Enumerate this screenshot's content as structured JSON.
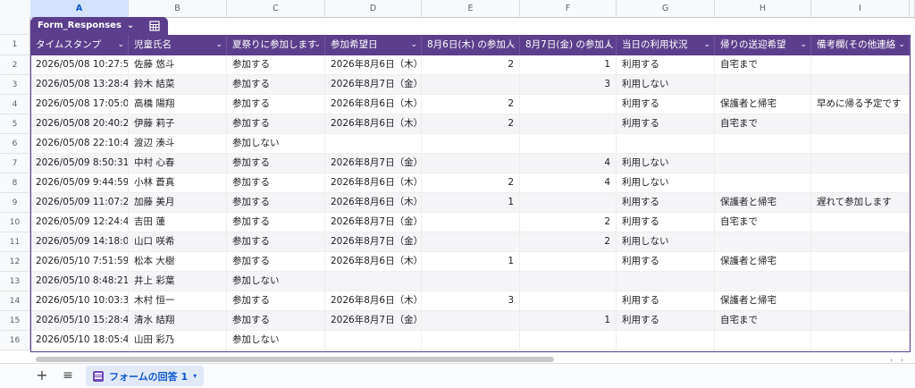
{
  "columns": [
    "A",
    "B",
    "C",
    "D",
    "E",
    "F",
    "G",
    "H",
    "I"
  ],
  "table_name": "Form_Responses",
  "headers": [
    "タイムスタンプ",
    "児童氏名",
    "夏祭りに参加します",
    "参加希望日",
    "8月6日(木) の参加人",
    "8月7日(金) の参加人",
    "当日の利用状況",
    "帰りの送迎希望",
    "備考欄(その他連絡"
  ],
  "row_numbers": [
    "1",
    "2",
    "3",
    "4",
    "5",
    "6",
    "7",
    "8",
    "9",
    "10",
    "11",
    "12",
    "13",
    "14",
    "15",
    "16"
  ],
  "rows": [
    [
      "2026/05/08 10:27:53",
      "佐藤 悠斗",
      "参加する",
      "2026年8月6日（木）, 20",
      "2",
      "1",
      "利用する",
      "自宅まで",
      ""
    ],
    [
      "2026/05/08 13:28:41",
      "鈴木 結菜",
      "参加する",
      "2026年8月7日（金）",
      "",
      "3",
      "利用しない",
      "",
      ""
    ],
    [
      "2026/05/08 17:05:06",
      "高橋 陽翔",
      "参加する",
      "2026年8月6日（木）",
      "2",
      "",
      "利用する",
      "保護者と帰宅",
      "早めに帰る予定です"
    ],
    [
      "2026/05/08 20:40:25",
      "伊藤 莉子",
      "参加する",
      "2026年8月6日（木）",
      "2",
      "",
      "利用する",
      "自宅まで",
      ""
    ],
    [
      "2026/05/08 22:10:49",
      "渡辺 湊斗",
      "参加しない",
      "",
      "",
      "",
      "",
      "",
      ""
    ],
    [
      "2026/05/09 8:50:31",
      "中村 心春",
      "参加する",
      "2026年8月7日（金）",
      "",
      "4",
      "利用しない",
      "",
      ""
    ],
    [
      "2026/05/09 9:44:59",
      "小林 蒼真",
      "参加する",
      "2026年8月6日（木）, 20",
      "2",
      "4",
      "利用しない",
      "",
      ""
    ],
    [
      "2026/05/09 11:07:27",
      "加藤 美月",
      "参加する",
      "2026年8月6日（木）",
      "1",
      "",
      "利用する",
      "保護者と帰宅",
      "遅れて参加します"
    ],
    [
      "2026/05/09 12:24:45",
      "吉田 蓮",
      "参加する",
      "2026年8月7日（金）",
      "",
      "2",
      "利用する",
      "自宅まで",
      ""
    ],
    [
      "2026/05/09 14:18:03",
      "山口 咲希",
      "参加する",
      "2026年8月7日（金）",
      "",
      "2",
      "利用しない",
      "",
      ""
    ],
    [
      "2026/05/10 7:51:59",
      "松本 大樹",
      "参加する",
      "2026年8月6日（木）",
      "1",
      "",
      "利用する",
      "保護者と帰宅",
      ""
    ],
    [
      "2026/05/10 8:48:21",
      "井上 彩葉",
      "参加しない",
      "",
      "",
      "",
      "",
      "",
      ""
    ],
    [
      "2026/05/10 10:03:38",
      "木村 恒一",
      "参加する",
      "2026年8月6日（木）",
      "3",
      "",
      "利用する",
      "保護者と帰宅",
      ""
    ],
    [
      "2026/05/10 15:28:42",
      "清水 結翔",
      "参加する",
      "2026年8月7日（金）",
      "",
      "1",
      "利用する",
      "自宅まで",
      ""
    ],
    [
      "2026/05/10 18:05:47",
      "山田 彩乃",
      "参加しない",
      "",
      "",
      "",
      "",
      "",
      ""
    ]
  ],
  "sheet_tab": "フォームの回答 1",
  "icons": {
    "add": "plus-icon",
    "list": "all-sheets-icon",
    "dropdown": "chevron-down-icon",
    "table": "table-view-icon"
  },
  "colors": {
    "table_header": "#5b3f8c",
    "tab_text": "#0b57d0"
  }
}
